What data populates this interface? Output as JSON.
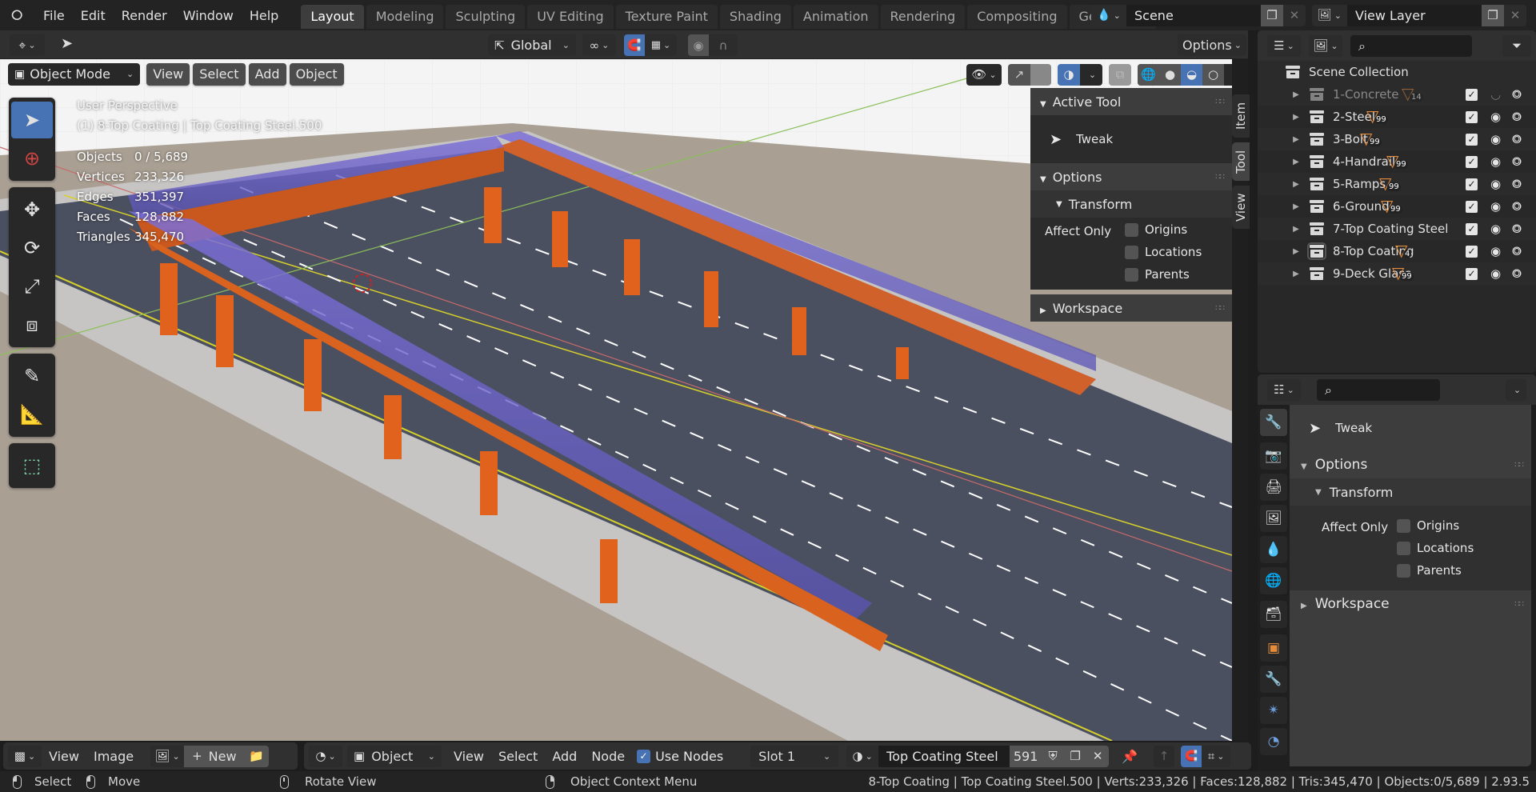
{
  "app": {
    "menu": [
      "File",
      "Edit",
      "Render",
      "Window",
      "Help"
    ],
    "workspace_tabs": [
      {
        "label": "Layout",
        "active": true
      },
      {
        "label": "Modeling",
        "active": false
      },
      {
        "label": "Sculpting",
        "active": false
      },
      {
        "label": "UV Editing",
        "active": false
      },
      {
        "label": "Texture Paint",
        "active": false
      },
      {
        "label": "Shading",
        "active": false
      },
      {
        "label": "Animation",
        "active": false
      },
      {
        "label": "Rendering",
        "active": false
      },
      {
        "label": "Compositing",
        "active": false
      },
      {
        "label": "Geometry Nod",
        "active": false
      }
    ],
    "scene_name": "Scene",
    "view_layer_name": "View Layer"
  },
  "tool_header": {
    "transform_orientation": "Global",
    "options_label": "Options"
  },
  "viewport": {
    "mode": "Object Mode",
    "menus": [
      "View",
      "Select",
      "Add",
      "Object"
    ],
    "overlay": {
      "view_name": "User Perspective",
      "active_info": "(1) 8-Top Coating | Top Coating Steel.500",
      "stats": [
        {
          "label": "Objects",
          "value": "0 / 5,689"
        },
        {
          "label": "Vertices",
          "value": "233,326"
        },
        {
          "label": "Edges",
          "value": "351,397"
        },
        {
          "label": "Faces",
          "value": "128,882"
        },
        {
          "label": "Triangles",
          "value": "345,470"
        }
      ]
    },
    "toolbar": [
      "tweak",
      "cursor",
      "move",
      "rotate",
      "scale",
      "transform",
      "annotate",
      "measure",
      "add-cube"
    ],
    "shading_active": "material-preview",
    "colors": {
      "accent": "#4772b3",
      "bridge_orange": "#e2621b",
      "roof_glass": "#6a63c8",
      "road": "#4a4f5e",
      "ground": "#a99f93",
      "sidewalk": "#c9c9c9"
    }
  },
  "npanel": {
    "tabs": [
      "Item",
      "Tool",
      "View"
    ],
    "active_tab": "Tool",
    "active_tool_header": "Active Tool",
    "active_tool": "Tweak",
    "options_header": "Options",
    "transform_header": "Transform",
    "affect_only_label": "Affect Only",
    "affect_only": [
      {
        "label": "Origins",
        "checked": false
      },
      {
        "label": "Locations",
        "checked": false
      },
      {
        "label": "Parents",
        "checked": false
      }
    ],
    "workspace_header": "Workspace"
  },
  "outliner": {
    "root": "Scene Collection",
    "collections": [
      {
        "name": "1-Concrete",
        "count": "14",
        "enabled": true,
        "visible": false,
        "dimmed": true
      },
      {
        "name": "2-Steel",
        "count": "99",
        "enabled": true,
        "visible": true,
        "dimmed": false
      },
      {
        "name": "3-Bolt",
        "count": "99",
        "enabled": true,
        "visible": true,
        "dimmed": false
      },
      {
        "name": "4-Handrail",
        "count": "99",
        "enabled": true,
        "visible": true,
        "dimmed": false
      },
      {
        "name": "5-Ramps",
        "count": "99",
        "enabled": true,
        "visible": true,
        "dimmed": false
      },
      {
        "name": "6-Ground",
        "count": "99",
        "enabled": true,
        "visible": true,
        "dimmed": false
      },
      {
        "name": "7-Top Coating Steel",
        "count": "",
        "enabled": true,
        "visible": true,
        "dimmed": false
      },
      {
        "name": "8-Top Coating",
        "count": "4",
        "enabled": true,
        "visible": true,
        "dimmed": false,
        "active": true
      },
      {
        "name": "9-Deck Glass",
        "count": "99",
        "enabled": true,
        "visible": true,
        "dimmed": false
      }
    ]
  },
  "properties": {
    "active_tool": "Tweak",
    "options_header": "Options",
    "transform_header": "Transform",
    "affect_only_label": "Affect Only",
    "affect_only": [
      {
        "label": "Origins",
        "checked": false
      },
      {
        "label": "Locations",
        "checked": false
      },
      {
        "label": "Parents",
        "checked": false
      }
    ],
    "workspace_header": "Workspace",
    "tabs": [
      "tool",
      "render",
      "output",
      "view-layer",
      "scene",
      "world",
      "collection",
      "object",
      "modifiers",
      "particles",
      "physics"
    ]
  },
  "bottom_header": {
    "image_menus": [
      "View",
      "Image"
    ],
    "new_label": "New",
    "object_type": "Object",
    "node_menus": [
      "View",
      "Select",
      "Add",
      "Node"
    ],
    "use_nodes_label": "Use Nodes",
    "use_nodes": true,
    "slot": "Slot 1",
    "material_name": "Top Coating Steel",
    "material_users": "591"
  },
  "statusbar": {
    "hints": [
      {
        "mouse": "l",
        "label": "Select"
      },
      {
        "mouse": "m",
        "label": "Move"
      },
      {
        "mouse": "m",
        "label": "Rotate View"
      },
      {
        "mouse": "r",
        "label": "Object Context Menu"
      }
    ],
    "info": "8-Top Coating | Top Coating Steel.500 | Verts:233,326 | Faces:128,882 | Tris:345,470 | Objects:0/5,689 | 2.93.5"
  }
}
